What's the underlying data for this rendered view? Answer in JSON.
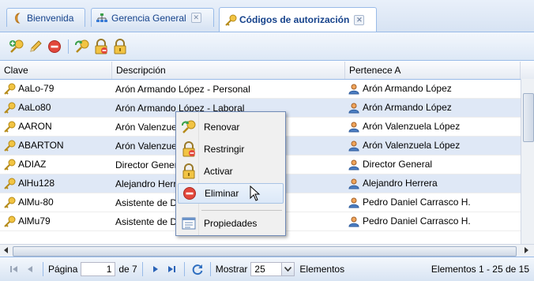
{
  "tabs": [
    {
      "label": "Bienvenida",
      "icon": "welcome-icon",
      "active": false
    },
    {
      "label": "Gerencia General",
      "icon": "org-chart-icon",
      "active": false
    },
    {
      "label": "Códigos de autorización",
      "icon": "key-icon",
      "active": true
    }
  ],
  "toolbar": {
    "buttons": [
      "add-key-icon",
      "edit-icon",
      "delete-icon",
      "renew-key-icon",
      "restrict-lock-icon",
      "unlock-icon"
    ]
  },
  "grid": {
    "columns": [
      "Clave",
      "Descripción",
      "Pertenece A"
    ],
    "rows": [
      {
        "clave": "AaLo-79",
        "descripcion": "Arón Armando López - Personal",
        "pertenece": "Arón Armando López"
      },
      {
        "clave": "AaLo80",
        "descripcion": "Arón Armando López - Laboral",
        "pertenece": "Arón Armando López"
      },
      {
        "clave": "AARON",
        "descripcion": "Arón Valenzuela López - Personal",
        "pertenece": "Arón Valenzuela López"
      },
      {
        "clave": "ABARTON",
        "descripcion": "Arón Valenzuela López - Laboral",
        "pertenece": "Arón Valenzuela López"
      },
      {
        "clave": "ADIAZ",
        "descripcion": "Director General",
        "pertenece": "Director General"
      },
      {
        "clave": "AlHu128",
        "descripcion": "Alejandro Herrera",
        "pertenece": "Alejandro Herrera"
      },
      {
        "clave": "AlMu-80",
        "descripcion": "Asistente de Dirección - Personal",
        "pertenece": "Pedro Daniel Carrasco H."
      },
      {
        "clave": "AlMu79",
        "descripcion": "Asistente de Dirección - Laboral",
        "pertenece": "Pedro Daniel Carrasco H."
      }
    ]
  },
  "context_menu": {
    "items": [
      {
        "label": "Renovar",
        "icon": "renew-key-icon"
      },
      {
        "label": "Restringir",
        "icon": "restrict-lock-icon"
      },
      {
        "label": "Activar",
        "icon": "unlock-icon"
      },
      {
        "label": "Eliminar",
        "icon": "delete-icon",
        "highlighted": true
      },
      {
        "label": "Propiedades",
        "icon": "properties-icon"
      }
    ]
  },
  "pager": {
    "page_label": "Página",
    "page_value": "1",
    "of_label": "de 7",
    "show_label": "Mostrar",
    "page_size": "25",
    "items_label": "Elementos",
    "info": "Elementos 1 - 25 de 15"
  },
  "colors": {
    "accent": "#15428b",
    "border": "#99bbe8",
    "row_alt": "#dfe8f6"
  }
}
